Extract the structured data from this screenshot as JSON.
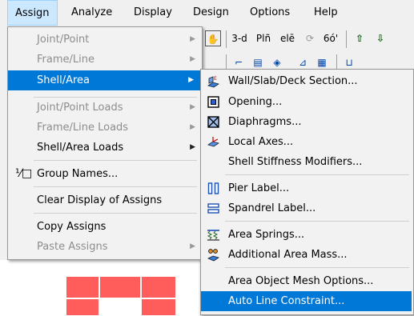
{
  "menubar": {
    "items": [
      {
        "label": "Assign"
      },
      {
        "label": "Analyze"
      },
      {
        "label": "Display"
      },
      {
        "label": "Design"
      },
      {
        "label": "Options"
      },
      {
        "label": "Help"
      }
    ]
  },
  "toolbar": {
    "row1": [
      "3-d",
      "Plñ",
      "elē",
      "⟳",
      "6ó'",
      "⇧",
      "⇩"
    ]
  },
  "assign_menu": {
    "items": [
      {
        "label": "Joint/Point",
        "disabled": true
      },
      {
        "label": "Frame/Line",
        "disabled": true
      },
      {
        "label": "Shell/Area",
        "disabled": false
      },
      {
        "label": "Joint/Point Loads",
        "disabled": true
      },
      {
        "label": "Frame/Line Loads",
        "disabled": true
      },
      {
        "label": "Shell/Area Loads",
        "disabled": false
      },
      {
        "label": "Group Names...",
        "disabled": false
      },
      {
        "label": "Clear Display of Assigns",
        "disabled": false
      },
      {
        "label": "Copy Assigns",
        "disabled": false
      },
      {
        "label": "Paste Assigns",
        "disabled": true
      }
    ]
  },
  "shell_submenu": {
    "items": [
      {
        "label": "Wall/Slab/Deck Section...",
        "icon": "wall-section-icon"
      },
      {
        "label": "Opening...",
        "icon": "opening-icon"
      },
      {
        "label": "Diaphragms...",
        "icon": "diaphragm-icon"
      },
      {
        "label": "Local Axes...",
        "icon": "local-axes-icon"
      },
      {
        "label": "Shell Stiffness Modifiers..."
      },
      {
        "label": "Pier Label...",
        "icon": "pier-icon"
      },
      {
        "label": "Spandrel Label...",
        "icon": "spandrel-icon"
      },
      {
        "label": "Area Springs...",
        "icon": "springs-icon"
      },
      {
        "label": "Additional Area Mass...",
        "icon": "mass-icon"
      },
      {
        "label": "Area Object Mesh Options..."
      },
      {
        "label": "Auto Line Constraint..."
      }
    ]
  },
  "colors": {
    "highlight": "#0078d7",
    "menubar_active": "#cce8ff",
    "canvas_fill": "#ff5c5c"
  }
}
